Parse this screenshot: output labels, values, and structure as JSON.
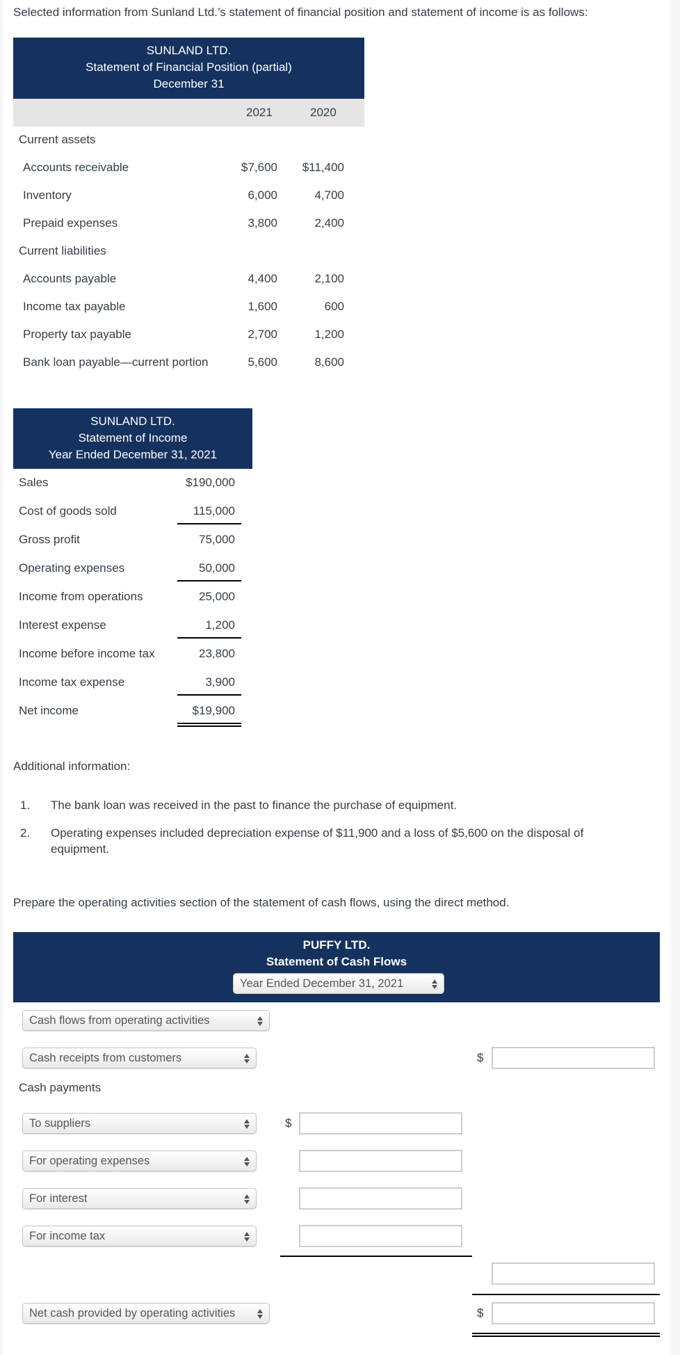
{
  "intro": "Selected information from Sunland Ltd.’s statement of financial position and statement of income is as follows:",
  "sfp": {
    "company": "SUNLAND LTD.",
    "title": "Statement of Financial Position (partial)",
    "date": "December 31",
    "col_2021": "2021",
    "col_2020": "2020",
    "section_assets": "Current assets",
    "section_liabilities": "Current liabilities",
    "rows": [
      {
        "label": "Accounts receivable",
        "y2021": "$7,600",
        "y2020": "$11,400"
      },
      {
        "label": "Inventory",
        "y2021": "6,000",
        "y2020": "4,700"
      },
      {
        "label": "Prepaid expenses",
        "y2021": "3,800",
        "y2020": "2,400"
      },
      {
        "label": "Accounts payable",
        "y2021": "4,400",
        "y2020": "2,100"
      },
      {
        "label": "Income tax payable",
        "y2021": "1,600",
        "y2020": "600"
      },
      {
        "label": "Property tax payable",
        "y2021": "2,700",
        "y2020": "1,200"
      },
      {
        "label": "Bank loan payable—current portion",
        "y2021": "5,600",
        "y2020": "8,600"
      }
    ]
  },
  "income": {
    "company": "SUNLAND LTD.",
    "title": "Statement of Income",
    "period": "Year Ended December 31, 2021",
    "rows": [
      {
        "label": "Sales",
        "value": "$190,000"
      },
      {
        "label": "Cost of goods sold",
        "value": "115,000"
      },
      {
        "label": "Gross profit",
        "value": "75,000"
      },
      {
        "label": "Operating expenses",
        "value": "50,000"
      },
      {
        "label": "Income from operations",
        "value": "25,000"
      },
      {
        "label": "Interest expense",
        "value": "1,200"
      },
      {
        "label": "Income before income tax",
        "value": "23,800"
      },
      {
        "label": "Income tax expense",
        "value": "3,900"
      },
      {
        "label": "Net income",
        "value": "$19,900"
      }
    ]
  },
  "additional": {
    "heading": "Additional information:",
    "items": [
      {
        "num": "1.",
        "text": "The bank loan was received in the past to finance the purchase of equipment."
      },
      {
        "num": "2.",
        "line1": "Operating expenses included depreciation expense of $11,900 and a loss of $5,600 on the disposal of",
        "line2": "equipment."
      }
    ]
  },
  "instruction": "Prepare the operating activities section of the statement of cash flows, using the direct method.",
  "cfs": {
    "company": "PUFFY LTD.",
    "title": "Statement of Cash Flows",
    "period_select": "Year Ended December 31, 2021",
    "section_select": "Cash flows from operating activities",
    "receipts_select": "Cash receipts from customers",
    "payments_label": "Cash payments",
    "payment_selects": [
      "To suppliers",
      "For operating expenses",
      "For interest",
      "For income tax"
    ],
    "net_select": "Net cash provided by operating activities",
    "currency": "$",
    "inputs": {
      "receipts": "",
      "suppliers": "",
      "operating": "",
      "interest": "",
      "income_tax": "",
      "total_payments": "",
      "net": ""
    }
  }
}
